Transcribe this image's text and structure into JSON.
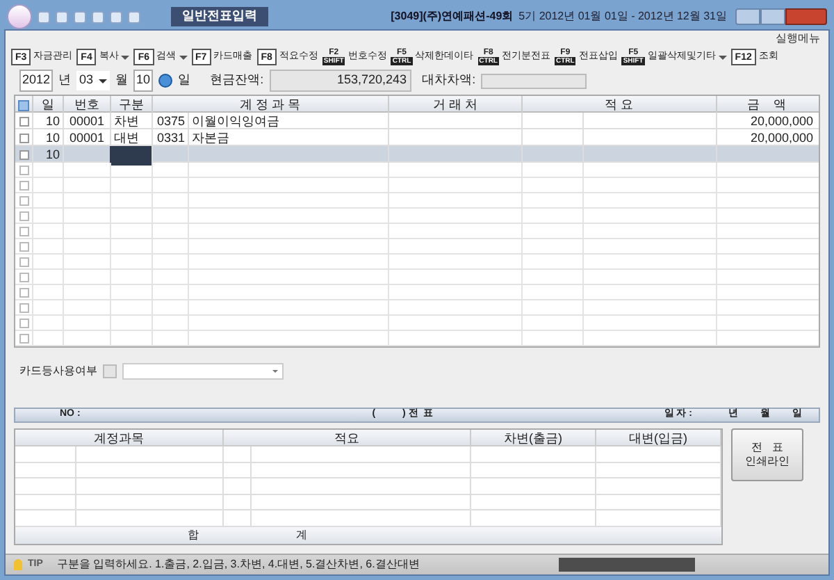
{
  "window": {
    "doc_title": "일반전표입력",
    "company": "[3049](주)연예패션-49회",
    "period": "5기 2012년 01월 01일 - 2012년 12월 31일"
  },
  "menu_label": "실행메뉴",
  "toolbar": [
    {
      "kind": "fkey",
      "key": "F3",
      "label": "자금관리",
      "dropdown": false
    },
    {
      "kind": "fkey",
      "key": "F4",
      "label": "복사",
      "dropdown": true
    },
    {
      "kind": "fkey",
      "key": "F6",
      "label": "검색",
      "dropdown": true
    },
    {
      "kind": "fkey",
      "key": "F7",
      "label": "카드매출",
      "dropdown": false
    },
    {
      "kind": "fkey",
      "key": "F8",
      "label": "적요수정",
      "dropdown": false
    },
    {
      "kind": "combo",
      "key": "F2",
      "mod": "SHIFT",
      "label": "번호수정",
      "dropdown": false
    },
    {
      "kind": "combo",
      "key": "F5",
      "mod": "CTRL",
      "label": "삭제한데이타",
      "dropdown": false
    },
    {
      "kind": "combo",
      "key": "F8",
      "mod": "CTRL",
      "label": "전기분전표",
      "dropdown": false
    },
    {
      "kind": "combo",
      "key": "F9",
      "mod": "CTRL",
      "label": "전표삽입",
      "dropdown": false
    },
    {
      "kind": "combo",
      "key": "F5",
      "mod": "SHIFT",
      "label": "일괄삭제및기타",
      "dropdown": true
    },
    {
      "kind": "fkey",
      "key": "F12",
      "label": "조회",
      "dropdown": false
    }
  ],
  "date": {
    "year": "2012",
    "year_unit": "년",
    "month": "03",
    "month_unit": "월",
    "day": "10",
    "day_unit": "일",
    "cash_label": "현금잔액:",
    "cash": "153,720,243",
    "diff_label": "대차차액:"
  },
  "table": {
    "columns": [
      "일",
      "번호",
      "구분",
      "계 정 과 목",
      "거 래 처",
      "적 요",
      "금    액"
    ],
    "rows": [
      {
        "day": "10",
        "no": "00001",
        "type": "차변",
        "code": "0375",
        "account": "이월이익잉여금",
        "amount": "20,000,000",
        "selected": false,
        "checked": false
      },
      {
        "day": "10",
        "no": "00001",
        "type": "대변",
        "code": "0331",
        "account": "자본금",
        "amount": "20,000,000",
        "selected": false,
        "checked": false
      },
      {
        "day": "10",
        "selected": true,
        "checked": false
      }
    ],
    "select_all_checked": false,
    "blank_rows": [
      {
        "checked": false
      },
      {
        "checked": false
      },
      {
        "checked": false
      },
      {
        "checked": false
      },
      {
        "checked": false
      },
      {
        "checked": false
      },
      {
        "checked": false
      },
      {
        "checked": false
      },
      {
        "checked": false
      },
      {
        "checked": false
      },
      {
        "checked": false
      },
      {
        "checked": false
      }
    ]
  },
  "card_label": "카드등사용여부",
  "card_checked": false,
  "slip_bar": {
    "no": "NO :",
    "slip": "(          ) 전  표",
    "date": "일 자 :",
    "y": "년",
    "m": "월",
    "d": "일"
  },
  "bottom_table": {
    "columns": [
      "계정과목",
      "적요",
      "차변(출금)",
      "대변(입금)"
    ],
    "total_a": "합",
    "total_b": "계"
  },
  "print_button": [
    "전   표",
    "인쇄라인"
  ],
  "status": {
    "tip": "TIP",
    "message": "구분을 입력하세요. 1.출금, 2.입금, 3.차변, 4.대변, 5.결산차변, 6.결산대변"
  }
}
